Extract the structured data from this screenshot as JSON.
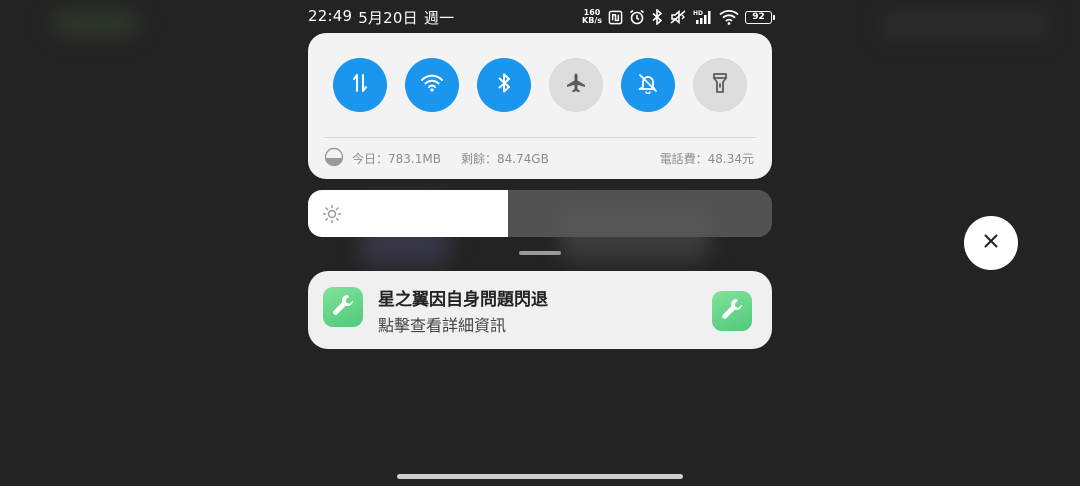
{
  "status_bar": {
    "time": "22:49",
    "date": "5月20日",
    "weekday": "週一",
    "net_speed_value": "160",
    "net_speed_unit": "KB/s",
    "battery": "92"
  },
  "quick_settings": {
    "toggles": [
      {
        "id": "mobile-data",
        "icon": "mobile-data-icon",
        "state": "on"
      },
      {
        "id": "wifi",
        "icon": "wifi-icon",
        "state": "on"
      },
      {
        "id": "bluetooth",
        "icon": "bluetooth-icon",
        "state": "on"
      },
      {
        "id": "airplane",
        "icon": "airplane-icon",
        "state": "off"
      },
      {
        "id": "silent",
        "icon": "bell-off-icon",
        "state": "on"
      },
      {
        "id": "flashlight",
        "icon": "flashlight-icon",
        "state": "off"
      }
    ],
    "data_usage": {
      "today": "今日：783.1MB",
      "remaining": "剩餘：84.74GB",
      "phone_bill": "電話費：48.34元"
    }
  },
  "brightness": {
    "level_fraction": 0.43,
    "icon": "sun-icon"
  },
  "notification": {
    "title": "星之翼因自身問題閃退",
    "subtitle": "點擊查看詳細資訊",
    "icon": "wrench-icon"
  },
  "colors": {
    "accent": "#1a96ef",
    "toggle_off": "#dcdcdc",
    "panel": "#f3f3f3",
    "background": "#232323",
    "app_icon": "#5fd184"
  }
}
